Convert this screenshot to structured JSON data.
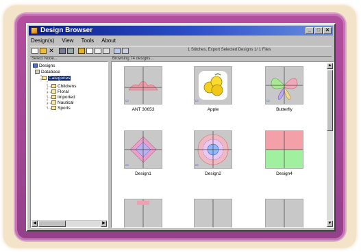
{
  "window": {
    "title": "Design Browser",
    "controls": [
      "_",
      "□",
      "✕"
    ]
  },
  "menu": [
    "Design(s)",
    "View",
    "Tools",
    "About"
  ],
  "toolbar": {
    "status_text": "1 Stitches, Export Selected Designs 1/ 1 Files"
  },
  "panes": {
    "left_label": "Select Node...",
    "right_label": "Browsing 74 designs..."
  },
  "tree": {
    "items": [
      {
        "label": "Designs",
        "level": 0,
        "selected": false
      },
      {
        "label": "Database",
        "level": 1,
        "selected": false
      },
      {
        "label": "Categories",
        "level": 2,
        "selected": true
      },
      {
        "label": "Childrens",
        "level": 3,
        "selected": false
      },
      {
        "label": "Floral",
        "level": 3,
        "selected": false
      },
      {
        "label": "Imported",
        "level": 3,
        "selected": false
      },
      {
        "label": "Nautical",
        "level": 3,
        "selected": false
      },
      {
        "label": "Sports",
        "level": 3,
        "selected": false
      }
    ]
  },
  "designs": [
    {
      "label": "ANT 30653",
      "kind": "ant"
    },
    {
      "label": "Apple",
      "kind": "apple"
    },
    {
      "label": "Butterfly",
      "kind": "butterfly"
    },
    {
      "label": "Design1",
      "kind": "diamond"
    },
    {
      "label": "Design2",
      "kind": "ring"
    },
    {
      "label": "Design4",
      "kind": "quad"
    }
  ],
  "colors": {
    "bezel": "#a4479a",
    "titlebar": "#0a1c8a",
    "selection": "#0a246a"
  }
}
